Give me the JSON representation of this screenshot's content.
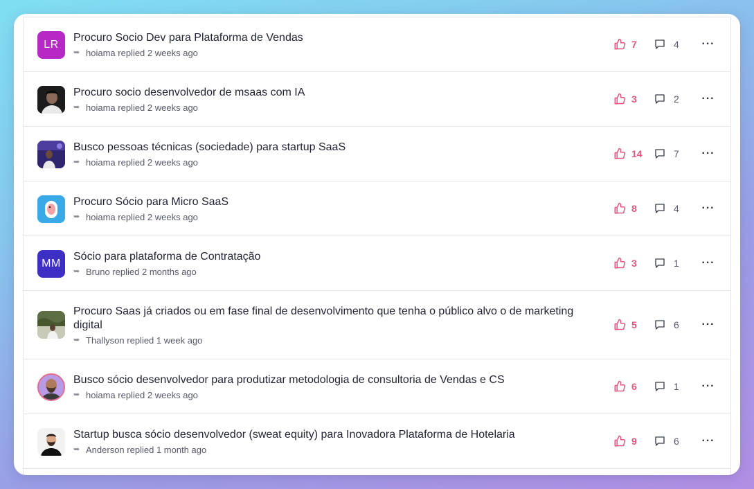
{
  "colors": {
    "like": "#e8537b",
    "avatar_lr": "#b629c4",
    "avatar_mm": "#3d2fc4"
  },
  "icons": {
    "like": "thumbs-up-icon",
    "comment": "comment-icon",
    "more": "more-options-icon",
    "reply": "reply-arrow-icon"
  },
  "topics": [
    {
      "title": "Procuro Socio Dev para Plataforma de Vendas",
      "avatar_initials": "LR",
      "replier": "hoiama",
      "replied_text": "replied",
      "time": "2 weeks ago",
      "likes": "7",
      "comments": "4"
    },
    {
      "title": "Procuro socio desenvolvedor de msaas com IA",
      "avatar_initials": "",
      "replier": "hoiama",
      "replied_text": "replied",
      "time": "2 weeks ago",
      "likes": "3",
      "comments": "2"
    },
    {
      "title": "Busco pessoas técnicas (sociedade) para startup SaaS",
      "avatar_initials": "",
      "replier": "hoiama",
      "replied_text": "replied",
      "time": "2 weeks ago",
      "likes": "14",
      "comments": "7"
    },
    {
      "title": "Procuro Sócio para Micro SaaS",
      "avatar_initials": "",
      "replier": "hoiama",
      "replied_text": "replied",
      "time": "2 weeks ago",
      "likes": "8",
      "comments": "4"
    },
    {
      "title": "Sócio para plataforma de Contratação",
      "avatar_initials": "MM",
      "replier": "Bruno",
      "replied_text": "replied",
      "time": "2 months ago",
      "likes": "3",
      "comments": "1"
    },
    {
      "title": "Procuro Saas já criados ou em fase final de desenvolvimento que tenha o público alvo o de marketing digital",
      "avatar_initials": "",
      "replier": "Thallyson",
      "replied_text": "replied",
      "time": "1 week ago",
      "likes": "5",
      "comments": "6"
    },
    {
      "title": "Busco sócio desenvolvedor para produtizar metodologia de consultoria de Vendas e CS",
      "avatar_initials": "",
      "replier": "hoiama",
      "replied_text": "replied",
      "time": "2 weeks ago",
      "likes": "6",
      "comments": "1"
    },
    {
      "title": "Startup busca sócio desenvolvedor (sweat equity) para Inovadora Plataforma de Hotelaria",
      "avatar_initials": "",
      "replier": "Anderson",
      "replied_text": "replied",
      "time": "1 month ago",
      "likes": "9",
      "comments": "6"
    }
  ]
}
